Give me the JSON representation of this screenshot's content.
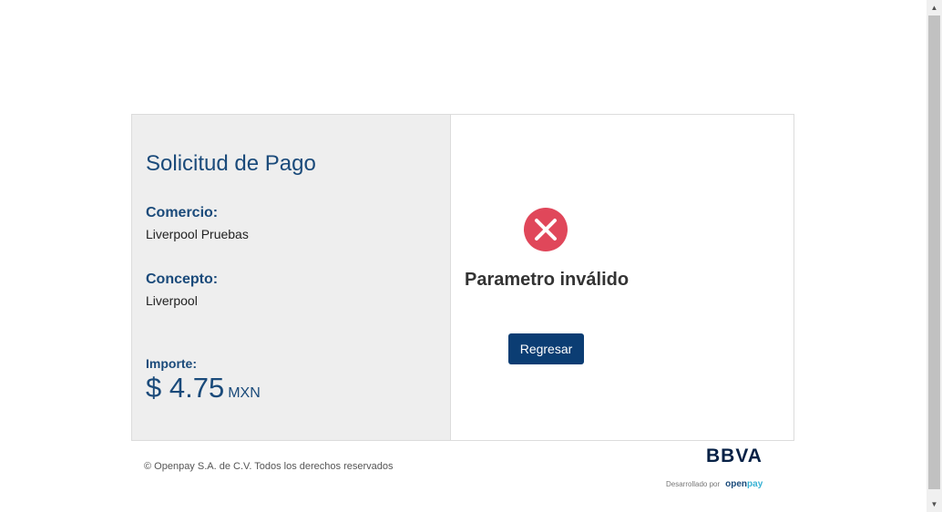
{
  "payment": {
    "title": "Solicitud de Pago",
    "merchant_label": "Comercio:",
    "merchant_value": "Liverpool Pruebas",
    "concept_label": "Concepto:",
    "concept_value": "Liverpool",
    "amount_label": "Importe:",
    "amount_value": "$ 4.75",
    "currency": "MXN"
  },
  "result": {
    "message": "Parametro inválido",
    "back_button": "Regresar",
    "icon": "error-x-icon",
    "icon_color": "#e0475a"
  },
  "footer": {
    "copyright": "© Openpay S.A. de C.V. Todos los derechos reservados",
    "developed_by": "Desarrollado por",
    "brand_logo": "BBVA",
    "openpay_logo_a": "open",
    "openpay_logo_b": "pay"
  },
  "colors": {
    "primary": "#0b3d73",
    "heading": "#1a4a7a",
    "panel": "#eeeeee"
  }
}
